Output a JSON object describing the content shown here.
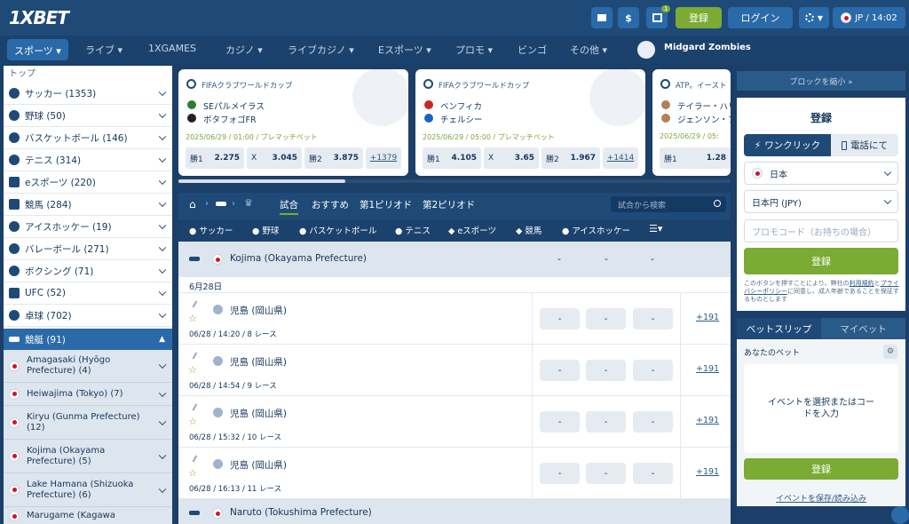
{
  "header": {
    "logo": "1XBET",
    "register_button": "登録",
    "login_button": "ログイン",
    "locale": "JP",
    "time": "14:02",
    "gift_badge": "1",
    "dollar_symbol": "$"
  },
  "nav": {
    "items": [
      {
        "label": "スポーツ"
      },
      {
        "label": "ライブ"
      },
      {
        "label": "1XGAMES"
      },
      {
        "label": "カジノ"
      },
      {
        "label": "ライブカジノ"
      },
      {
        "label": "Eスポーツ"
      },
      {
        "label": "プロモ"
      },
      {
        "label": "ビンゴ"
      },
      {
        "label": "その他"
      }
    ],
    "promo_label": "Midgard Zombies"
  },
  "sidebar": {
    "top_label": "トップ",
    "sports": [
      {
        "label": "サッカー (1353)",
        "icon": "soccer-ball-icon"
      },
      {
        "label": "野球 (50)",
        "icon": "baseball-icon"
      },
      {
        "label": "バスケットボール (146)",
        "icon": "basketball-icon"
      },
      {
        "label": "テニス (314)",
        "icon": "tennis-ball-icon"
      },
      {
        "label": "eスポーツ (220)",
        "icon": "gamepad-icon"
      },
      {
        "label": "競馬 (284)",
        "icon": "horse-icon"
      },
      {
        "label": "アイスホッケー (19)",
        "icon": "hockey-puck-icon"
      },
      {
        "label": "バレーボール (271)",
        "icon": "volleyball-icon"
      },
      {
        "label": "ボクシング (71)",
        "icon": "boxing-glove-icon"
      },
      {
        "label": "UFC (52)",
        "icon": "ufc-icon"
      },
      {
        "label": "卓球 (702)",
        "icon": "table-tennis-icon"
      }
    ],
    "active_sport": "競艇 (91)",
    "subitems": [
      {
        "label": "Amagasaki (Hyōgo Prefecture) (4)"
      },
      {
        "label": "Heiwajima (Tokyo) (7)"
      },
      {
        "label": "Kiryu (Gunma Prefecture) (12)"
      },
      {
        "label": "Kojima (Okayama Prefecture) (5)"
      },
      {
        "label": "Lake Hamana (Shizuoka Prefecture) (6)"
      },
      {
        "label": "Marugame (Kagawa"
      }
    ]
  },
  "cards": [
    {
      "league": "FIFAクラブワールドカップ",
      "team1": "SEパルメイラス",
      "team2": "ボタフォゴFR",
      "date": "2025/06/29 / 01:00 / プレマッチベット",
      "odds": [
        {
          "label": "勝1",
          "value": "2.275"
        },
        {
          "label": "X",
          "value": "3.045"
        },
        {
          "label": "勝2",
          "value": "3.875"
        }
      ],
      "more": "+1379"
    },
    {
      "league": "FIFAクラブワールドカップ",
      "team1": "ベンフィカ",
      "team2": "チェルシー",
      "date": "2025/06/29 / 05:00 / プレマッチベット",
      "odds": [
        {
          "label": "勝1",
          "value": "4.105"
        },
        {
          "label": "X",
          "value": "3.65"
        },
        {
          "label": "勝2",
          "value": "1.967"
        }
      ],
      "more": "+1414"
    },
    {
      "league": "ATP。イースト",
      "team1": "テイラー・ハリ",
      "team2": "ジェンソン・ブ",
      "date": "2025/06/29 / 05:",
      "odds": [
        {
          "label": "勝1",
          "value": "1.28"
        }
      ],
      "more": ""
    }
  ],
  "main": {
    "tabs": [
      "試合",
      "おすすめ",
      "第1ピリオド",
      "第2ピリオド"
    ],
    "search_placeholder": "試合から検索",
    "sport_filters": [
      "サッカー",
      "野球",
      "バスケットボール",
      "テニス",
      "eスポーツ",
      "競馬",
      "アイスホッケー"
    ],
    "group_title": "Kojima (Okayama Prefecture)",
    "group_dashes": [
      "-",
      "-",
      "-"
    ],
    "date_label": "6月28日",
    "events": [
      {
        "name": "児島 (岡山県)",
        "meta": "06/28 / 14:20 / 8 レース",
        "odds": [
          "-",
          "-",
          "-"
        ],
        "more": "+191"
      },
      {
        "name": "児島 (岡山県)",
        "meta": "06/28 / 14:54 / 9 レース",
        "odds": [
          "-",
          "-",
          "-"
        ],
        "more": "+191"
      },
      {
        "name": "児島 (岡山県)",
        "meta": "06/28 / 15:32 / 10 レース",
        "odds": [
          "-",
          "-",
          "-"
        ],
        "more": "+191"
      },
      {
        "name": "児島 (岡山県)",
        "meta": "06/28 / 16:13 / 11 レース",
        "odds": [
          "-",
          "-",
          "-"
        ],
        "more": "+191"
      }
    ],
    "next_group_title": "Naruto (Tokushima Prefecture)"
  },
  "right": {
    "collapse_label": "ブロックを縮小 »",
    "register_title": "登録",
    "one_click": "ワンクリック",
    "by_phone": "電話にて",
    "country": "日本",
    "currency": "日本円 (JPY)",
    "promo_placeholder": "プロモコード（お持ちの場合）",
    "register_button": "登録",
    "terms_prefix": "このボタンを押すことにより、弊社の",
    "terms_link": "利用規約",
    "terms_and": "と",
    "privacy_link": "プライバシーポリシー",
    "terms_suffix": "に同意し、成人年齢であることを保証するものとします",
    "betslip_tab": "ベットスリップ",
    "mybet_tab": "マイベット",
    "your_bet": "あなたのベット",
    "empty_msg": "イベントを選択またはコードを入力",
    "register_button2": "登録",
    "save_load": "イベントを保存/読み込み"
  },
  "colors": {
    "accent_green": "#7bab32",
    "header_blue": "#1f4a78",
    "active_blue": "#2a6aa8"
  }
}
